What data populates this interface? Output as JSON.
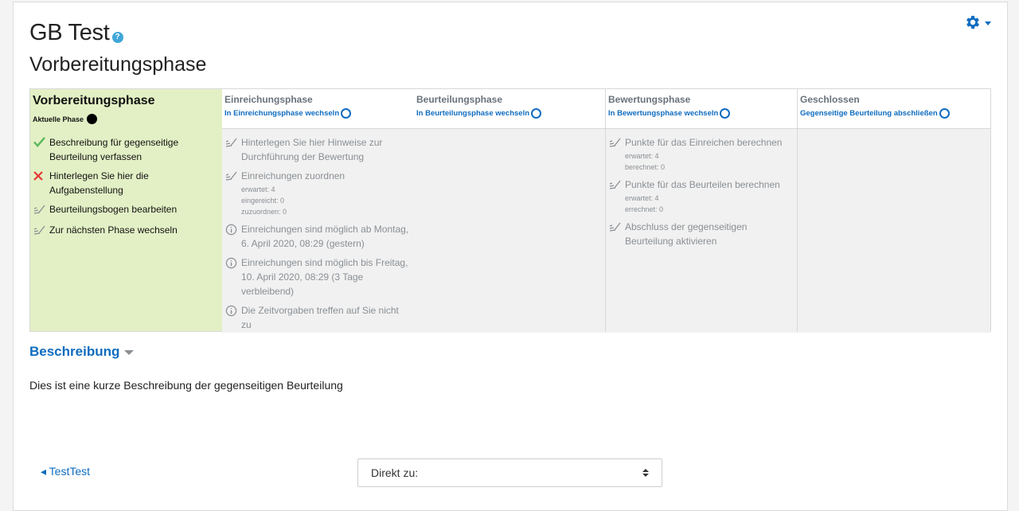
{
  "header": {
    "title": "GB Test",
    "help_icon": "question-circle-icon",
    "subtitle": "Vorbereitungsphase",
    "settings_icon": "gear-icon"
  },
  "colors": {
    "accent": "#0f6cbf",
    "active_phase_bg": "#e3f0c5",
    "inactive_bg": "#f1f1f1",
    "done": "#5cb85c",
    "fail": "#e53935"
  },
  "phases": [
    {
      "name": "Vorbereitungsphase",
      "status": "Aktuelle Phase",
      "tasks": [
        {
          "status": "done",
          "text": "Beschreibung für gegenseitige Beurteilung verfassen"
        },
        {
          "status": "fail",
          "text": "Hinterlegen Sie hier die Aufgabenstellung"
        },
        {
          "status": "todo",
          "text": "Beurteilungsbogen bearbeiten"
        },
        {
          "status": "todo",
          "text": "Zur nächsten Phase wechseln"
        }
      ]
    },
    {
      "name": "Einreichungsphase",
      "switch_label": "In Einreichungsphase wechseln",
      "tasks": [
        {
          "status": "todo",
          "text": "Hinterlegen Sie hier Hinweise zur Durchführung der Bewertung"
        },
        {
          "status": "todo",
          "text": "Einreichungen zuordnen",
          "details": [
            "erwartet: 4",
            "eingereicht: 0",
            "zuzuordnen: 0"
          ]
        },
        {
          "status": "info",
          "text": "Einreichungen sind möglich ab Montag, 6. April 2020, 08:29 (gestern)"
        },
        {
          "status": "info",
          "text": "Einreichungen sind möglich bis Freitag, 10. April 2020, 08:29 (3 Tage verbleibend)"
        },
        {
          "status": "info",
          "text": "Die Zeitvorgaben treffen auf Sie nicht zu"
        }
      ]
    },
    {
      "name": "Beurteilungsphase",
      "switch_label": "In Beurteilungsphase wechseln",
      "tasks": []
    },
    {
      "name": "Bewertungsphase",
      "switch_label": "In Bewertungsphase wechseln",
      "tasks": [
        {
          "status": "todo",
          "text": "Punkte für das Einreichen berechnen",
          "details": [
            "erwartet: 4",
            "berechnet: 0"
          ]
        },
        {
          "status": "todo",
          "text": "Punkte für das Beurteilen berechnen",
          "details": [
            "erwartet: 4",
            "errechnet: 0"
          ]
        },
        {
          "status": "todo",
          "text": "Abschluss der gegenseitigen Beurteilung aktivieren"
        }
      ]
    },
    {
      "name": "Geschlossen",
      "switch_label": "Gegenseitige Beurteilung abschließen",
      "tasks": []
    }
  ],
  "description": {
    "heading": "Beschreibung",
    "text": "Dies ist eine kurze Beschreibung der gegenseitigen Beurteilung"
  },
  "footer": {
    "prev_link": "◂ TestTest",
    "jump_select": "Direkt zu:"
  }
}
